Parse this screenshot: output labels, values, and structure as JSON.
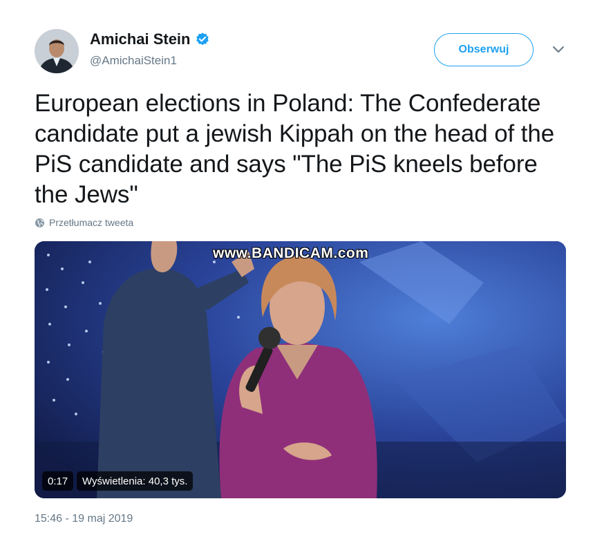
{
  "colors": {
    "accent": "#1da1f2",
    "text_primary": "#14171a",
    "text_secondary": "#657786"
  },
  "author": {
    "display_name": "Amichai Stein",
    "handle": "@AmichaiStein1",
    "verified": true,
    "verified_icon": "verified-badge-icon"
  },
  "header": {
    "follow_label": "Obserwuj",
    "more_icon": "chevron-down-icon"
  },
  "tweet": {
    "text": "European elections in Poland: The Confederate candidate put a jewish Kippah on the head of the PiS candidate and says \"The PiS kneels before the Jews\"",
    "translate_label": "Przetłumacz tweeta",
    "translate_icon": "globe-icon"
  },
  "media": {
    "watermark": "www.BANDICAM.com",
    "duration": "0:17",
    "views": "Wyświetlenia: 40,3 tys."
  },
  "timestamp": "15:46 - 19 maj 2019"
}
